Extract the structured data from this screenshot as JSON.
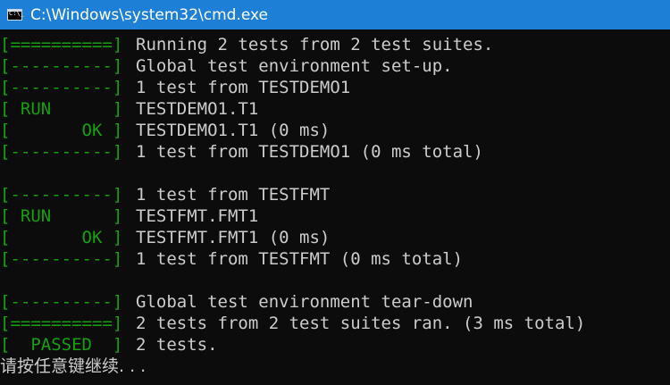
{
  "window": {
    "title": "C:\\Windows\\system32\\cmd.exe",
    "icon": "cmd-icon",
    "icon_prompt": "C:\\_"
  },
  "colors": {
    "titlebar": "#1e7fd6",
    "background": "#0c0c0c",
    "text": "#cccccc",
    "tag": "#13a10e"
  },
  "console": {
    "lines": [
      {
        "tag": "[==========]",
        "text": "Running 2 tests from 2 test suites."
      },
      {
        "tag": "[----------]",
        "text": "Global test environment set-up."
      },
      {
        "tag": "[----------]",
        "text": "1 test from TESTDEMO1"
      },
      {
        "tag": "[ RUN      ]",
        "text": "TESTDEMO1.T1"
      },
      {
        "tag": "[       OK ]",
        "text": "TESTDEMO1.T1 (0 ms)"
      },
      {
        "tag": "[----------]",
        "text": "1 test from TESTDEMO1 (0 ms total)"
      },
      {
        "tag": "",
        "text": ""
      },
      {
        "tag": "[----------]",
        "text": "1 test from TESTFMT"
      },
      {
        "tag": "[ RUN      ]",
        "text": "TESTFMT.FMT1"
      },
      {
        "tag": "[       OK ]",
        "text": "TESTFMT.FMT1 (0 ms)"
      },
      {
        "tag": "[----------]",
        "text": "1 test from TESTFMT (0 ms total)"
      },
      {
        "tag": "",
        "text": ""
      },
      {
        "tag": "[----------]",
        "text": "Global test environment tear-down"
      },
      {
        "tag": "[==========]",
        "text": "2 tests from 2 test suites ran. (3 ms total)"
      },
      {
        "tag": "[  PASSED  ]",
        "text": "2 tests."
      }
    ],
    "prompt": "请按任意键继续. . ."
  }
}
